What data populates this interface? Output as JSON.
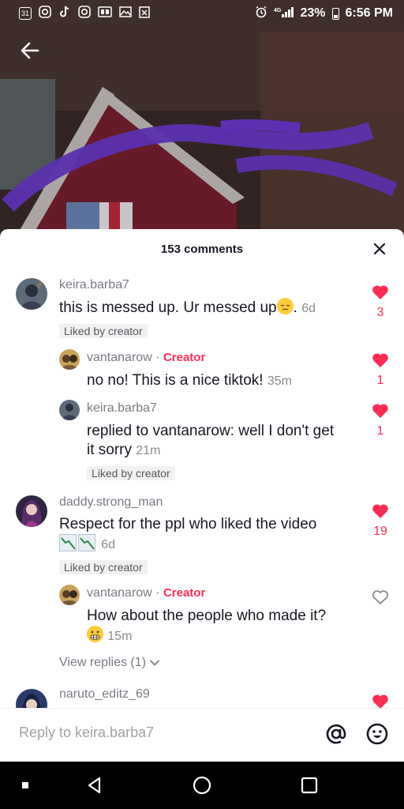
{
  "status_bar": {
    "battery": "23%",
    "time": "6:56 PM",
    "calendar_day": "31"
  },
  "sheet": {
    "title": "153 comments"
  },
  "comments": [
    {
      "username": "keira.barba7",
      "text": "this is messed up. Ur messed up",
      "time": "6d",
      "liked_by_creator": "Liked by creator",
      "likes": "3",
      "liked": true,
      "replies": [
        {
          "username": "vantanarow",
          "creator_label": "Creator",
          "text": "no no! This is a nice tiktok!",
          "time": "35m",
          "likes": "1",
          "liked": true
        },
        {
          "username": "keira.barba7",
          "text_line1": "replied to vantanarow: well I don't get",
          "text_line2": "it sorry",
          "time": "21m",
          "liked_by_creator": "Liked by creator",
          "likes": "1",
          "liked": true
        }
      ]
    },
    {
      "username": "daddy.strong_man",
      "text": "Respect for the ppl who liked the video",
      "time": "6d",
      "liked_by_creator": "Liked by creator",
      "likes": "19",
      "liked": true,
      "replies": [
        {
          "username": "vantanarow",
          "creator_label": "Creator",
          "text": "How about the people who made it?",
          "time": "15m",
          "liked": false
        }
      ],
      "view_replies": "View replies (1)"
    },
    {
      "username": "naruto_editz_69",
      "liked": true
    }
  ],
  "reply_bar": {
    "placeholder": "Reply to keira.barba7"
  },
  "colors": {
    "accent": "#fe2c55",
    "text": "#161823",
    "muted": "#7a7a85"
  }
}
